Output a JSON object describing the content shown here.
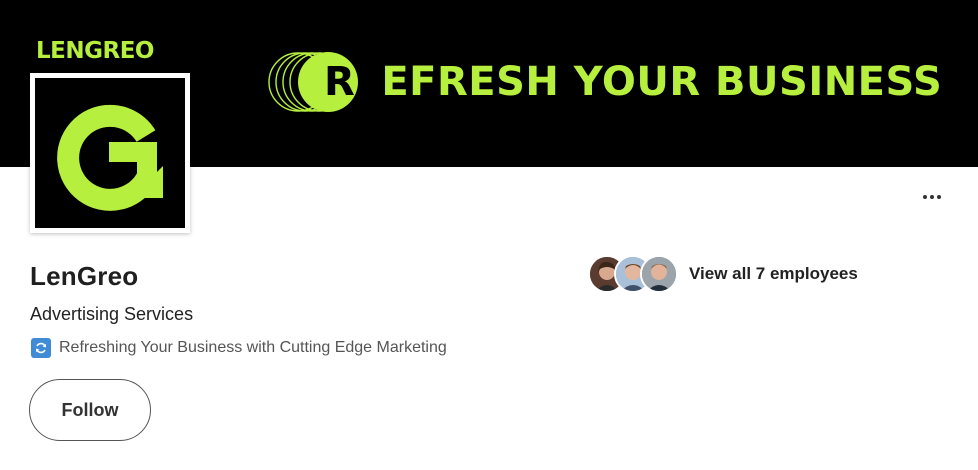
{
  "banner": {
    "brand": "LENGREO",
    "tagline": "REFRESH YOUR BUSINESS",
    "ring_letter": "R",
    "accent_color": "#b6ef3d"
  },
  "logo": {
    "letter": "G",
    "icon": "lengreo-logo"
  },
  "company": {
    "name": "LenGreo",
    "industry": "Advertising Services",
    "tagline": "Refreshing Your Business with Cutting Edge Marketing",
    "tagline_icon": "refresh-icon"
  },
  "actions": {
    "follow_label": "Follow",
    "more_icon": "more-options-icon"
  },
  "employees": {
    "link_text": "View all 7 employees"
  }
}
